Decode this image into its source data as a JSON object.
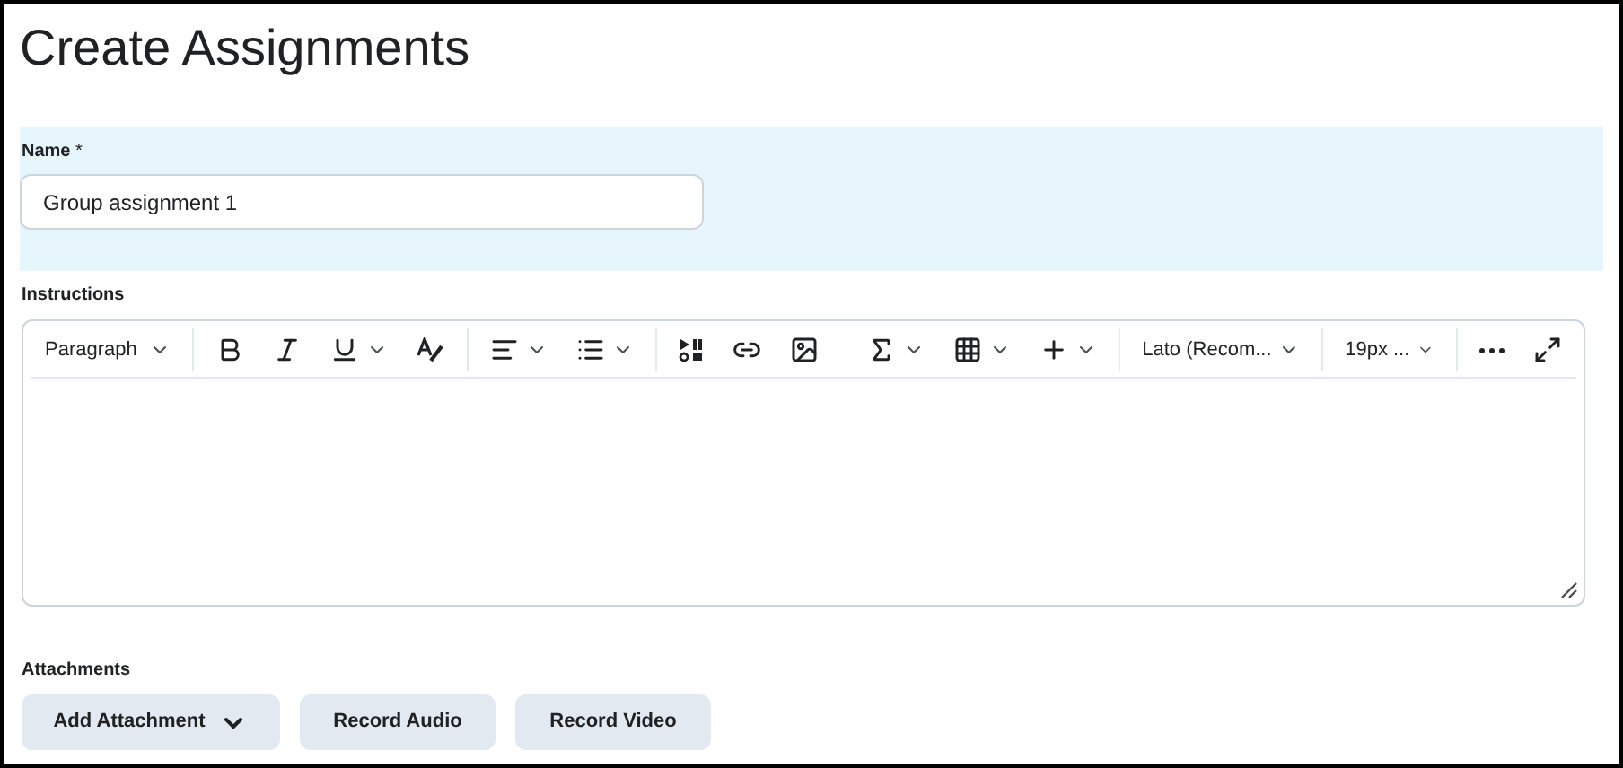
{
  "title": "Create Assignments",
  "name_field": {
    "label": "Name",
    "required_mark": "*",
    "value": "Group assignment 1"
  },
  "instructions": {
    "label": "Instructions",
    "toolbar": {
      "format": "Paragraph",
      "font": "Lato (Recom...",
      "size": "19px ..."
    }
  },
  "attachments": {
    "label": "Attachments",
    "buttons": [
      {
        "label": "Add Attachment",
        "kind": "menu"
      },
      {
        "label": "Record Audio",
        "kind": "plain"
      },
      {
        "label": "Record Video",
        "kind": "plain"
      }
    ]
  }
}
